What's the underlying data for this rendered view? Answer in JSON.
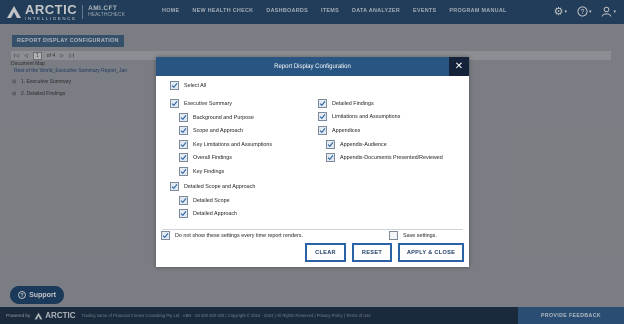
{
  "brand": {
    "name": "ARCTIC",
    "tagline": "INTELLIGENCE",
    "sub_brand_name": "AMI.CFT",
    "sub_brand_tag": "HEALTHCHECK"
  },
  "nav": [
    "HOME",
    "NEW HEALTH CHECK",
    "DASHBOARDS",
    "ITEMS",
    "DATA ANALYZER",
    "EVENTS",
    "PROGRAM MANUAL"
  ],
  "page": {
    "header": "REPORT DISPLAY CONFIGURATION"
  },
  "toolbar": {
    "first": "|◁",
    "prev": "◁",
    "page": "1",
    "of": "of 4",
    "next": "▷",
    "last": "▷|"
  },
  "document_map": {
    "title": "Document Map",
    "root": "Rest of the World_Executive Summary Report_Jan",
    "items": [
      "1. Executive Summary",
      "2. Detailed Findings"
    ]
  },
  "support_label": "Support",
  "footer": {
    "powered": "Powered by",
    "brand": "ARCTIC",
    "legal": "Trading name of Financial Crimes Consulting Pty Ltd · ABN · 00 000 000 000 | Copyright © 2015 - 2024 | All Rights Reserved | Privacy Policy | Terms of Use",
    "feedback": "PROVIDE FEEDBACK"
  },
  "modal": {
    "title": "Report Display Configuration",
    "close": "✕",
    "select_all": "Select All",
    "left": [
      "Executive Summary",
      "Background and Purpose",
      "Scope and Approach",
      "Key Limitations and Assumptions",
      "Overall Findings",
      "Key Findings",
      "Detailed Scope and Approach",
      "Detailed Scope",
      "Detailed Approach"
    ],
    "right": [
      "Detailed Findings",
      "Limitations and Assumptions",
      "Appendices",
      "Appendix-Audience",
      "Appendix-Documents Presented/Reviewed"
    ],
    "dont_show": "Do not show these settings every time report renders.",
    "save_settings": "Save settings.",
    "buttons": {
      "clear": "CLEAR",
      "reset": "RESET",
      "apply": "APPLY & CLOSE"
    }
  },
  "colors": {
    "topbar": "#1f4468",
    "modal_header": "#285581",
    "button_border": "#2a62a5",
    "footer": "#152a40",
    "feedback": "#2c5a8c"
  }
}
